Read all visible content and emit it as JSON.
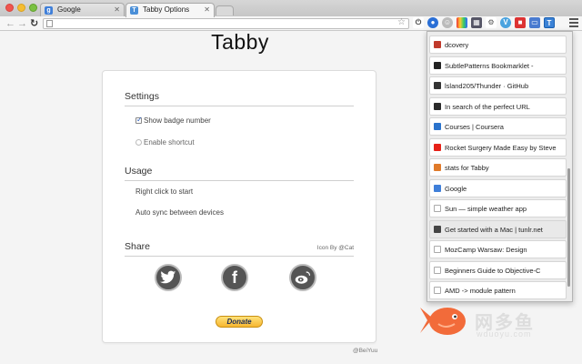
{
  "browser": {
    "tabs": [
      {
        "title": "Google",
        "active": false,
        "favicon": "google-g-icon"
      },
      {
        "title": "Tabby Options",
        "active": true,
        "favicon": "tabby-t-icon"
      }
    ],
    "address": "",
    "extensions": [
      "power-icon",
      "ext-blue-circle",
      "ext-grey-face",
      "ext-color-square",
      "ext-grid",
      "ext-gear",
      "ext-v",
      "ext-red",
      "ext-monitor",
      "ext-tabby-active"
    ]
  },
  "page": {
    "title": "Tabby",
    "settings_heading": "Settings",
    "show_badge_label": "Show badge number",
    "show_badge_checked": true,
    "enable_shortcut_label": "Enable shortcut",
    "enable_shortcut_checked": false,
    "usage_heading": "Usage",
    "usage_lines": [
      "Right click to start",
      "Auto sync between devices"
    ],
    "share_heading": "Share",
    "icon_credit": "Icon By @Cat",
    "social": [
      "twitter-icon",
      "facebook-icon",
      "weibo-icon"
    ],
    "donate_label": "Donate",
    "footer_credit": "@BeiYuu"
  },
  "dropdown": {
    "items": [
      {
        "title": "dcovery",
        "icon": "dcovery-icon",
        "color": "#c0392b"
      },
      {
        "title": "SubtlePatterns Bookmarklet -",
        "icon": "subtlepatterns-icon",
        "color": "#222222"
      },
      {
        "title": "lsland205/Thunder · GitHub",
        "icon": "github-icon",
        "color": "#333333"
      },
      {
        "title": "In search of the perfect URL",
        "icon": "terminal-icon",
        "color": "#2a2a2a"
      },
      {
        "title": "Courses | Coursera",
        "icon": "coursera-icon",
        "color": "#2a73cc"
      },
      {
        "title": "Rocket Surgery Made Easy by Steve",
        "icon": "youtube-icon",
        "color": "#e62117"
      },
      {
        "title": "stats for Tabby",
        "icon": "stats-icon",
        "color": "#e07a2a"
      },
      {
        "title": "Google",
        "icon": "google-g-icon",
        "color": "#3f7fd9"
      },
      {
        "title": "Sun — simple weather app",
        "icon": "page-icon",
        "color": "doc"
      },
      {
        "title": "Get started with a Mac | tunlr.net",
        "icon": "tunlr-icon",
        "color": "#444444",
        "selected": true
      },
      {
        "title": "MozCamp Warsaw: Design",
        "icon": "page-icon",
        "color": "doc"
      },
      {
        "title": "Beginners Guide to Objective-C",
        "icon": "page-icon",
        "color": "doc"
      },
      {
        "title": "AMD -> module pattern",
        "icon": "page-icon",
        "color": "doc"
      }
    ]
  },
  "watermark": {
    "cn": "网多鱼",
    "url": "wduoyu.com"
  }
}
